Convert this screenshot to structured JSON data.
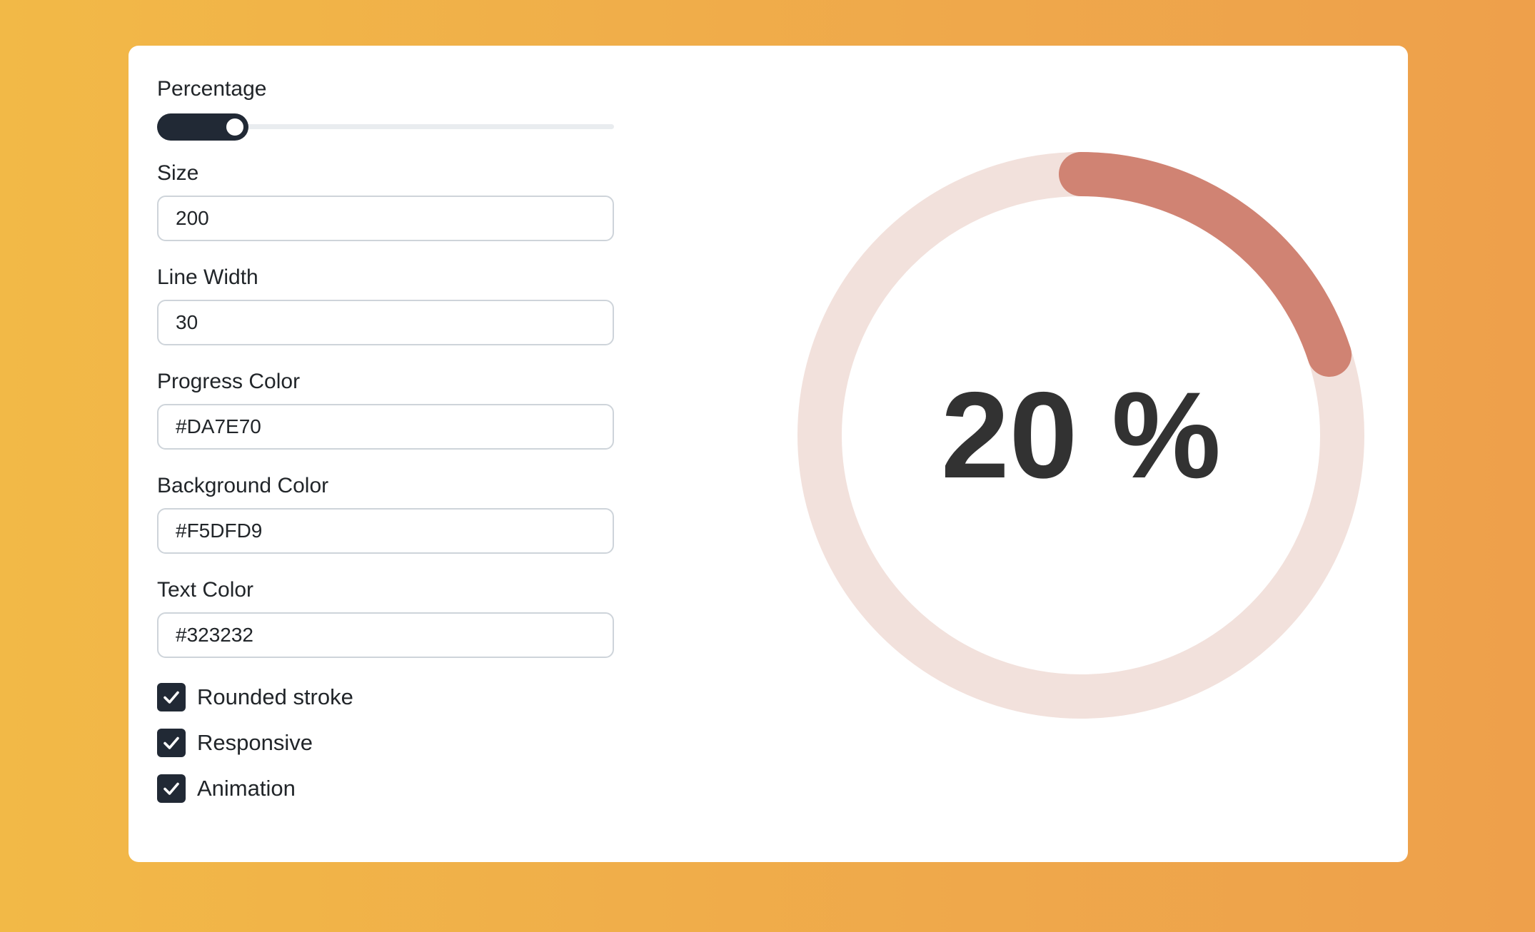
{
  "form": {
    "percentage_label": "Percentage",
    "percentage_value": 0.2,
    "size_label": "Size",
    "size_value": "200",
    "line_width_label": "Line Width",
    "line_width_value": "30",
    "progress_color_label": "Progress Color",
    "progress_color_value": "#DA7E70",
    "background_color_label": "Background Color",
    "background_color_value": "#F5DFD9",
    "text_color_label": "Text Color",
    "text_color_value": "#323232",
    "checkboxes": [
      {
        "label": "Rounded stroke",
        "checked": true
      },
      {
        "label": "Responsive",
        "checked": true
      },
      {
        "label": "Animation",
        "checked": true
      }
    ]
  },
  "gauge": {
    "text": "20 %",
    "progress": 0.2,
    "progress_color": "#D08373",
    "track_color": "#F2E1DC",
    "text_color": "#323232"
  },
  "colors": {
    "accent_dark": "#212935",
    "card_background": "#FFFFFF"
  },
  "icons": {
    "checkbox": "check-icon"
  }
}
